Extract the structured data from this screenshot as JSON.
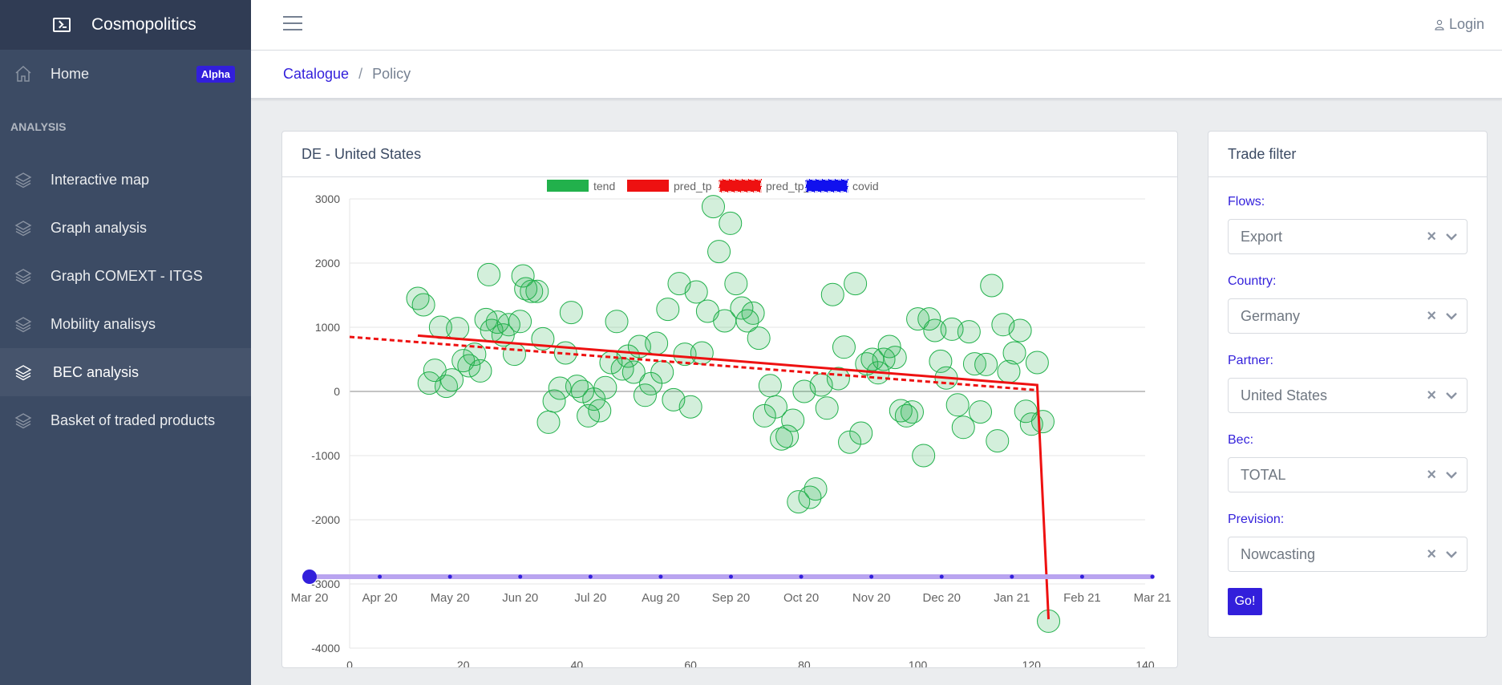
{
  "brand": {
    "name": "Cosmopolitics",
    "icon": "terminal-icon"
  },
  "sidebar": {
    "home": {
      "label": "Home",
      "badge": "Alpha",
      "icon": "home-icon"
    },
    "section_title": "ANALYSIS",
    "items": [
      {
        "label": "Interactive map",
        "icon": "layers-icon"
      },
      {
        "label": "Graph analysis",
        "icon": "layers-icon"
      },
      {
        "label": "Graph COMEXT - ITGS",
        "icon": "layers-icon"
      },
      {
        "label": "Mobility analisys",
        "icon": "layers-icon"
      },
      {
        "label": "BEC analysis",
        "icon": "layers-icon",
        "active": true
      },
      {
        "label": "Basket of traded products",
        "icon": "layers-icon"
      }
    ]
  },
  "header": {
    "login_label": "Login",
    "menu_icon": "hamburger-icon",
    "user_icon": "user-icon"
  },
  "breadcrumb": {
    "link": "Catalogue",
    "separator": "/",
    "current": "Policy"
  },
  "chart_card": {
    "title": "DE - United States"
  },
  "filter": {
    "title": "Trade filter",
    "flows": {
      "label": "Flows:",
      "value": "Export"
    },
    "country": {
      "label": "Country:",
      "value": "Germany"
    },
    "partner": {
      "label": "Partner:",
      "value": "United States"
    },
    "bec": {
      "label": "Bec:",
      "value": "TOTAL"
    },
    "prevision": {
      "label": "Prevision:",
      "value": "Nowcasting"
    },
    "go_label": "Go!"
  },
  "timeline": {
    "labels": [
      "Mar 20",
      "Apr 20",
      "May 20",
      "Jun 20",
      "Jul 20",
      "Aug 20",
      "Sep 20",
      "Oct 20",
      "Nov 20",
      "Dec 20",
      "Jan 21",
      "Feb 21",
      "Mar 21"
    ],
    "selected_index": 0
  },
  "colors": {
    "tend": "#22b14c",
    "pred_tp": "#ee1111",
    "pred_tp_c": "#ee1111",
    "covid": "#1111ee",
    "accent": "#321fdb",
    "timeline": "#b9a4f0"
  },
  "chart_data": {
    "type": "scatter",
    "legend_position": "top",
    "xlim": [
      0,
      140
    ],
    "ylim": [
      -4000,
      3000
    ],
    "xticks": [
      0,
      20,
      40,
      60,
      80,
      100,
      120,
      140
    ],
    "yticks": [
      3000,
      2000,
      1000,
      0,
      -1000,
      -2000,
      -3000,
      -4000
    ],
    "grid": true,
    "series": [
      {
        "name": "tend",
        "type": "scatter",
        "points": [
          [
            12,
            1450
          ],
          [
            13,
            1350
          ],
          [
            14,
            130
          ],
          [
            15,
            330
          ],
          [
            16,
            1000
          ],
          [
            17,
            80
          ],
          [
            18,
            180
          ],
          [
            19,
            980
          ],
          [
            20,
            480
          ],
          [
            21,
            400
          ],
          [
            22,
            580
          ],
          [
            23,
            320
          ],
          [
            24,
            1120
          ],
          [
            24.5,
            1820
          ],
          [
            25,
            950
          ],
          [
            26,
            1080
          ],
          [
            27,
            880
          ],
          [
            28,
            1040
          ],
          [
            29,
            580
          ],
          [
            30,
            1090
          ],
          [
            30.5,
            1800
          ],
          [
            31,
            1600
          ],
          [
            32,
            1560
          ],
          [
            33,
            1560
          ],
          [
            34,
            820
          ],
          [
            35,
            -480
          ],
          [
            36,
            -150
          ],
          [
            37,
            50
          ],
          [
            38,
            600
          ],
          [
            39,
            1230
          ],
          [
            40,
            80
          ],
          [
            41,
            0
          ],
          [
            42,
            -380
          ],
          [
            43,
            -120
          ],
          [
            44,
            -300
          ],
          [
            45,
            60
          ],
          [
            46,
            450
          ],
          [
            47,
            1090
          ],
          [
            48,
            350
          ],
          [
            49,
            550
          ],
          [
            50,
            300
          ],
          [
            51,
            700
          ],
          [
            52,
            -60
          ],
          [
            53,
            120
          ],
          [
            54,
            750
          ],
          [
            55,
            300
          ],
          [
            56,
            1280
          ],
          [
            57,
            -130
          ],
          [
            58,
            1680
          ],
          [
            59,
            580
          ],
          [
            60,
            -240
          ],
          [
            61,
            1550
          ],
          [
            62,
            600
          ],
          [
            63,
            1250
          ],
          [
            64,
            2880
          ],
          [
            65,
            2180
          ],
          [
            66,
            1100
          ],
          [
            67,
            2620
          ],
          [
            68,
            1680
          ],
          [
            69,
            1300
          ],
          [
            70,
            1100
          ],
          [
            71,
            1220
          ],
          [
            72,
            830
          ],
          [
            73,
            -380
          ],
          [
            74,
            90
          ],
          [
            75,
            -240
          ],
          [
            76,
            -740
          ],
          [
            77,
            -700
          ],
          [
            78,
            -450
          ],
          [
            79,
            -1720
          ],
          [
            80,
            0
          ],
          [
            81,
            -1650
          ],
          [
            82,
            -1520
          ],
          [
            83,
            100
          ],
          [
            84,
            -260
          ],
          [
            85,
            1510
          ],
          [
            86,
            200
          ],
          [
            87,
            690
          ],
          [
            88,
            -790
          ],
          [
            89,
            1680
          ],
          [
            90,
            -650
          ],
          [
            91,
            430
          ],
          [
            92,
            500
          ],
          [
            93,
            290
          ],
          [
            94,
            500
          ],
          [
            95,
            700
          ],
          [
            96,
            530
          ],
          [
            97,
            -300
          ],
          [
            98,
            -380
          ],
          [
            99,
            -320
          ],
          [
            100,
            1130
          ],
          [
            101,
            -1000
          ],
          [
            102,
            1130
          ],
          [
            103,
            950
          ],
          [
            104,
            470
          ],
          [
            105,
            210
          ],
          [
            106,
            970
          ],
          [
            107,
            -210
          ],
          [
            108,
            -560
          ],
          [
            109,
            930
          ],
          [
            110,
            430
          ],
          [
            111,
            -320
          ],
          [
            112,
            420
          ],
          [
            113,
            1650
          ],
          [
            114,
            -770
          ],
          [
            115,
            1040
          ],
          [
            116,
            310
          ],
          [
            117,
            600
          ],
          [
            118,
            950
          ],
          [
            119,
            -310
          ],
          [
            120,
            -510
          ],
          [
            121,
            450
          ],
          [
            122,
            -470
          ],
          [
            123,
            -3580
          ]
        ]
      },
      {
        "name": "pred_tp",
        "type": "line",
        "points": [
          [
            12,
            870
          ],
          [
            121,
            100
          ],
          [
            123,
            -3550
          ]
        ]
      },
      {
        "name": "pred_tp_c",
        "type": "line",
        "style": "dashed",
        "points": [
          [
            0,
            850
          ],
          [
            121,
            20
          ]
        ]
      },
      {
        "name": "covid",
        "type": "line",
        "style": "dashed",
        "points": []
      }
    ]
  }
}
